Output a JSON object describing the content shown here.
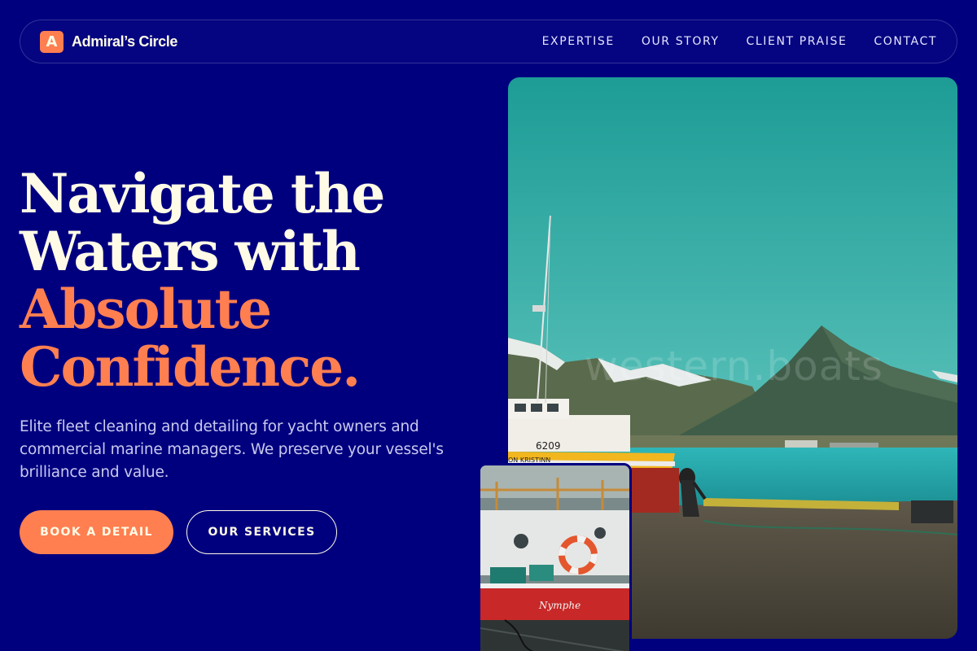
{
  "brand": {
    "mark": "A",
    "name": "Admiral’s Circle"
  },
  "nav": {
    "items": [
      "EXPERTISE",
      "OUR STORY",
      "CLIENT PRAISE",
      "CONTACT"
    ]
  },
  "hero": {
    "headline_lines": [
      "Navigate the",
      "Waters with",
      "Absolute",
      "Confidence."
    ],
    "subtext": "Elite fleet cleaning and detailing for yacht owners and commercial marine managers. We preserve your vessel's brilliance and value.",
    "primary_button": "BOOK A DETAIL",
    "secondary_button": "OUR SERVICES"
  },
  "main_photo": {
    "watermark": "western.boats",
    "boat_number": "6209",
    "boat_name": "ON KRISTINN"
  },
  "small_photo": {
    "boat_name": "Nymphe"
  },
  "colors": {
    "background": "#00007f",
    "accent": "#ff7f50",
    "text_light": "#fffbe6",
    "text_muted": "#c9c9ee"
  }
}
